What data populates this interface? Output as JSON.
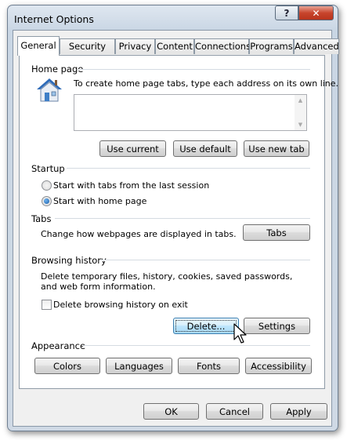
{
  "window": {
    "title": "Internet Options",
    "help_glyph": "?",
    "close_glyph": "✕"
  },
  "tabs": [
    {
      "label": "General",
      "active": true
    },
    {
      "label": "Security"
    },
    {
      "label": "Privacy"
    },
    {
      "label": "Content"
    },
    {
      "label": "Connections"
    },
    {
      "label": "Programs"
    },
    {
      "label": "Advanced"
    }
  ],
  "home_page": {
    "group_label": "Home page",
    "description": "To create home page tabs, type each address on its own line.",
    "address_value": "",
    "use_current": "Use current",
    "use_default": "Use default",
    "use_new_tab": "Use new tab"
  },
  "startup": {
    "group_label": "Startup",
    "option_last_session": "Start with tabs from the last session",
    "option_home_page": "Start with home page",
    "selected": "home_page"
  },
  "tabs_section": {
    "group_label": "Tabs",
    "description": "Change how webpages are displayed in tabs.",
    "button": "Tabs"
  },
  "browsing_history": {
    "group_label": "Browsing history",
    "description": "Delete temporary files, history, cookies, saved passwords, and web form information.",
    "delete_on_exit": "Delete browsing history on exit",
    "delete_on_exit_checked": false,
    "delete_button": "Delete...",
    "settings_button": "Settings"
  },
  "appearance": {
    "group_label": "Appearance",
    "colors": "Colors",
    "languages": "Languages",
    "fonts": "Fonts",
    "accessibility": "Accessibility"
  },
  "footer": {
    "ok": "OK",
    "cancel": "Cancel",
    "apply": "Apply"
  },
  "colors": {
    "house_roof": "#2e6bb8",
    "house_wall": "#e9eef5",
    "close_red": "#c8452d",
    "accent_blue": "#3c7fb1"
  }
}
